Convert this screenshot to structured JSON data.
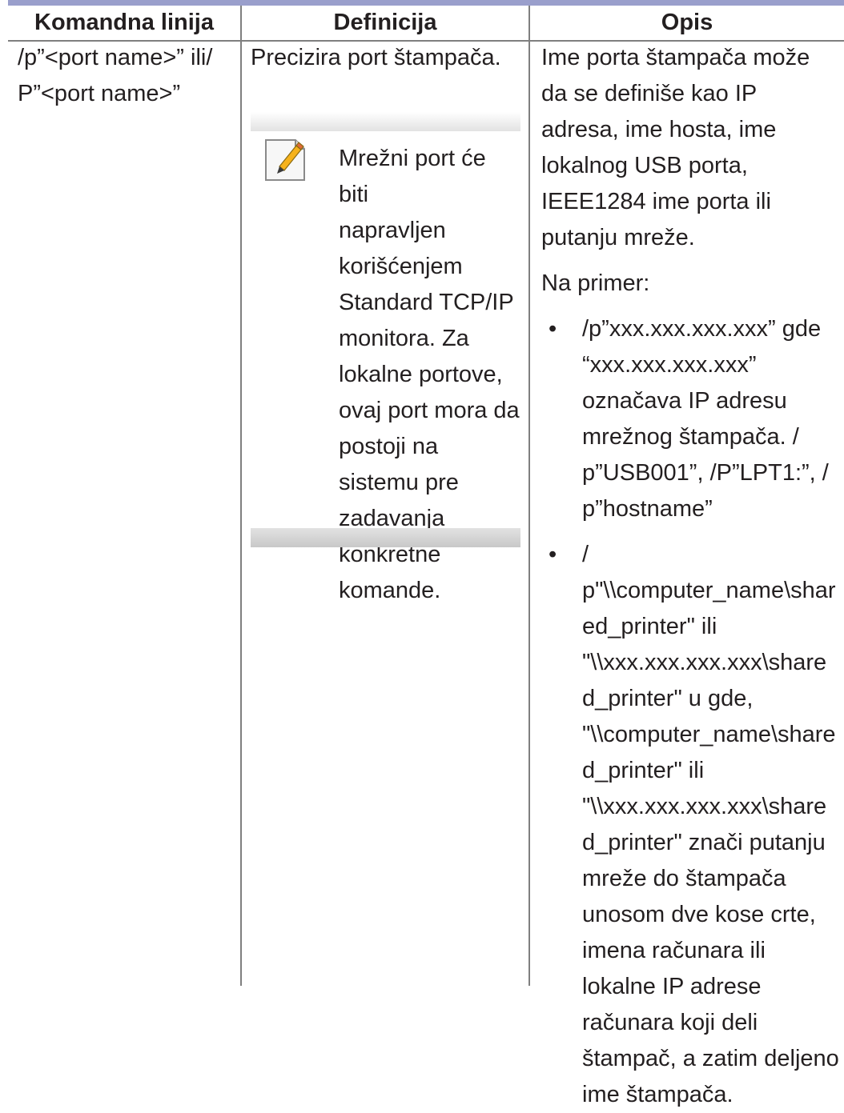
{
  "table": {
    "headers": [
      "Komandna linija",
      "Definicija",
      "Opis"
    ],
    "command": [
      "/p”<port name>” ili/",
      "P”<port name>”"
    ],
    "definition": "Precizira port štampača.",
    "note": [
      "Mrežni port će biti",
      "napravljen",
      "korišćenjem",
      "Standard TCP/IP",
      "monitora. Za",
      "lokalne portove,",
      "ovaj port mora da",
      "postoji na",
      "sistemu pre",
      "zadavanja",
      "konkretne",
      "komande."
    ],
    "description_lines": [
      "Ime porta štampača može",
      "da se definiše kao IP",
      "adresa, ime hosta, ime",
      "lokalnog USB porta,",
      "IEEE1284 ime porta ili",
      "putanju mreže."
    ],
    "example_label": "Na primer:",
    "bullet_char": "•",
    "bullet1": [
      "/p”xxx.xxx.xxx.xxx” gde",
      "“xxx.xxx.xxx.xxx”",
      "označava IP adresu",
      "mrežnog štampača. /",
      "p”USB001”, /P”LPT1:”, /",
      "p”hostname”"
    ],
    "bullet2": [
      "/",
      "p\"\\\\computer_name\\shar",
      "ed_printer\" ili",
      "\"\\\\xxx.xxx.xxx.xxx\\share",
      "d_printer\" u gde,",
      "\"\\\\computer_name\\share",
      "d_printer\" ili",
      "\"\\\\xxx.xxx.xxx.xxx\\share",
      "d_printer\" znači putanju",
      "mreže do štampača",
      "unosom dve kose crte,",
      "imena računara ili",
      "lokalne IP adrese",
      "računara koji deli",
      "štampač, a zatim deljeno",
      "ime štampača."
    ]
  },
  "icons": {
    "note_icon": "note-pencil-icon"
  },
  "colors": {
    "header_rule": "#9a9fcc",
    "grid": "#7f7f7f",
    "text": "#231f20",
    "pencil": "#f6b21b"
  }
}
